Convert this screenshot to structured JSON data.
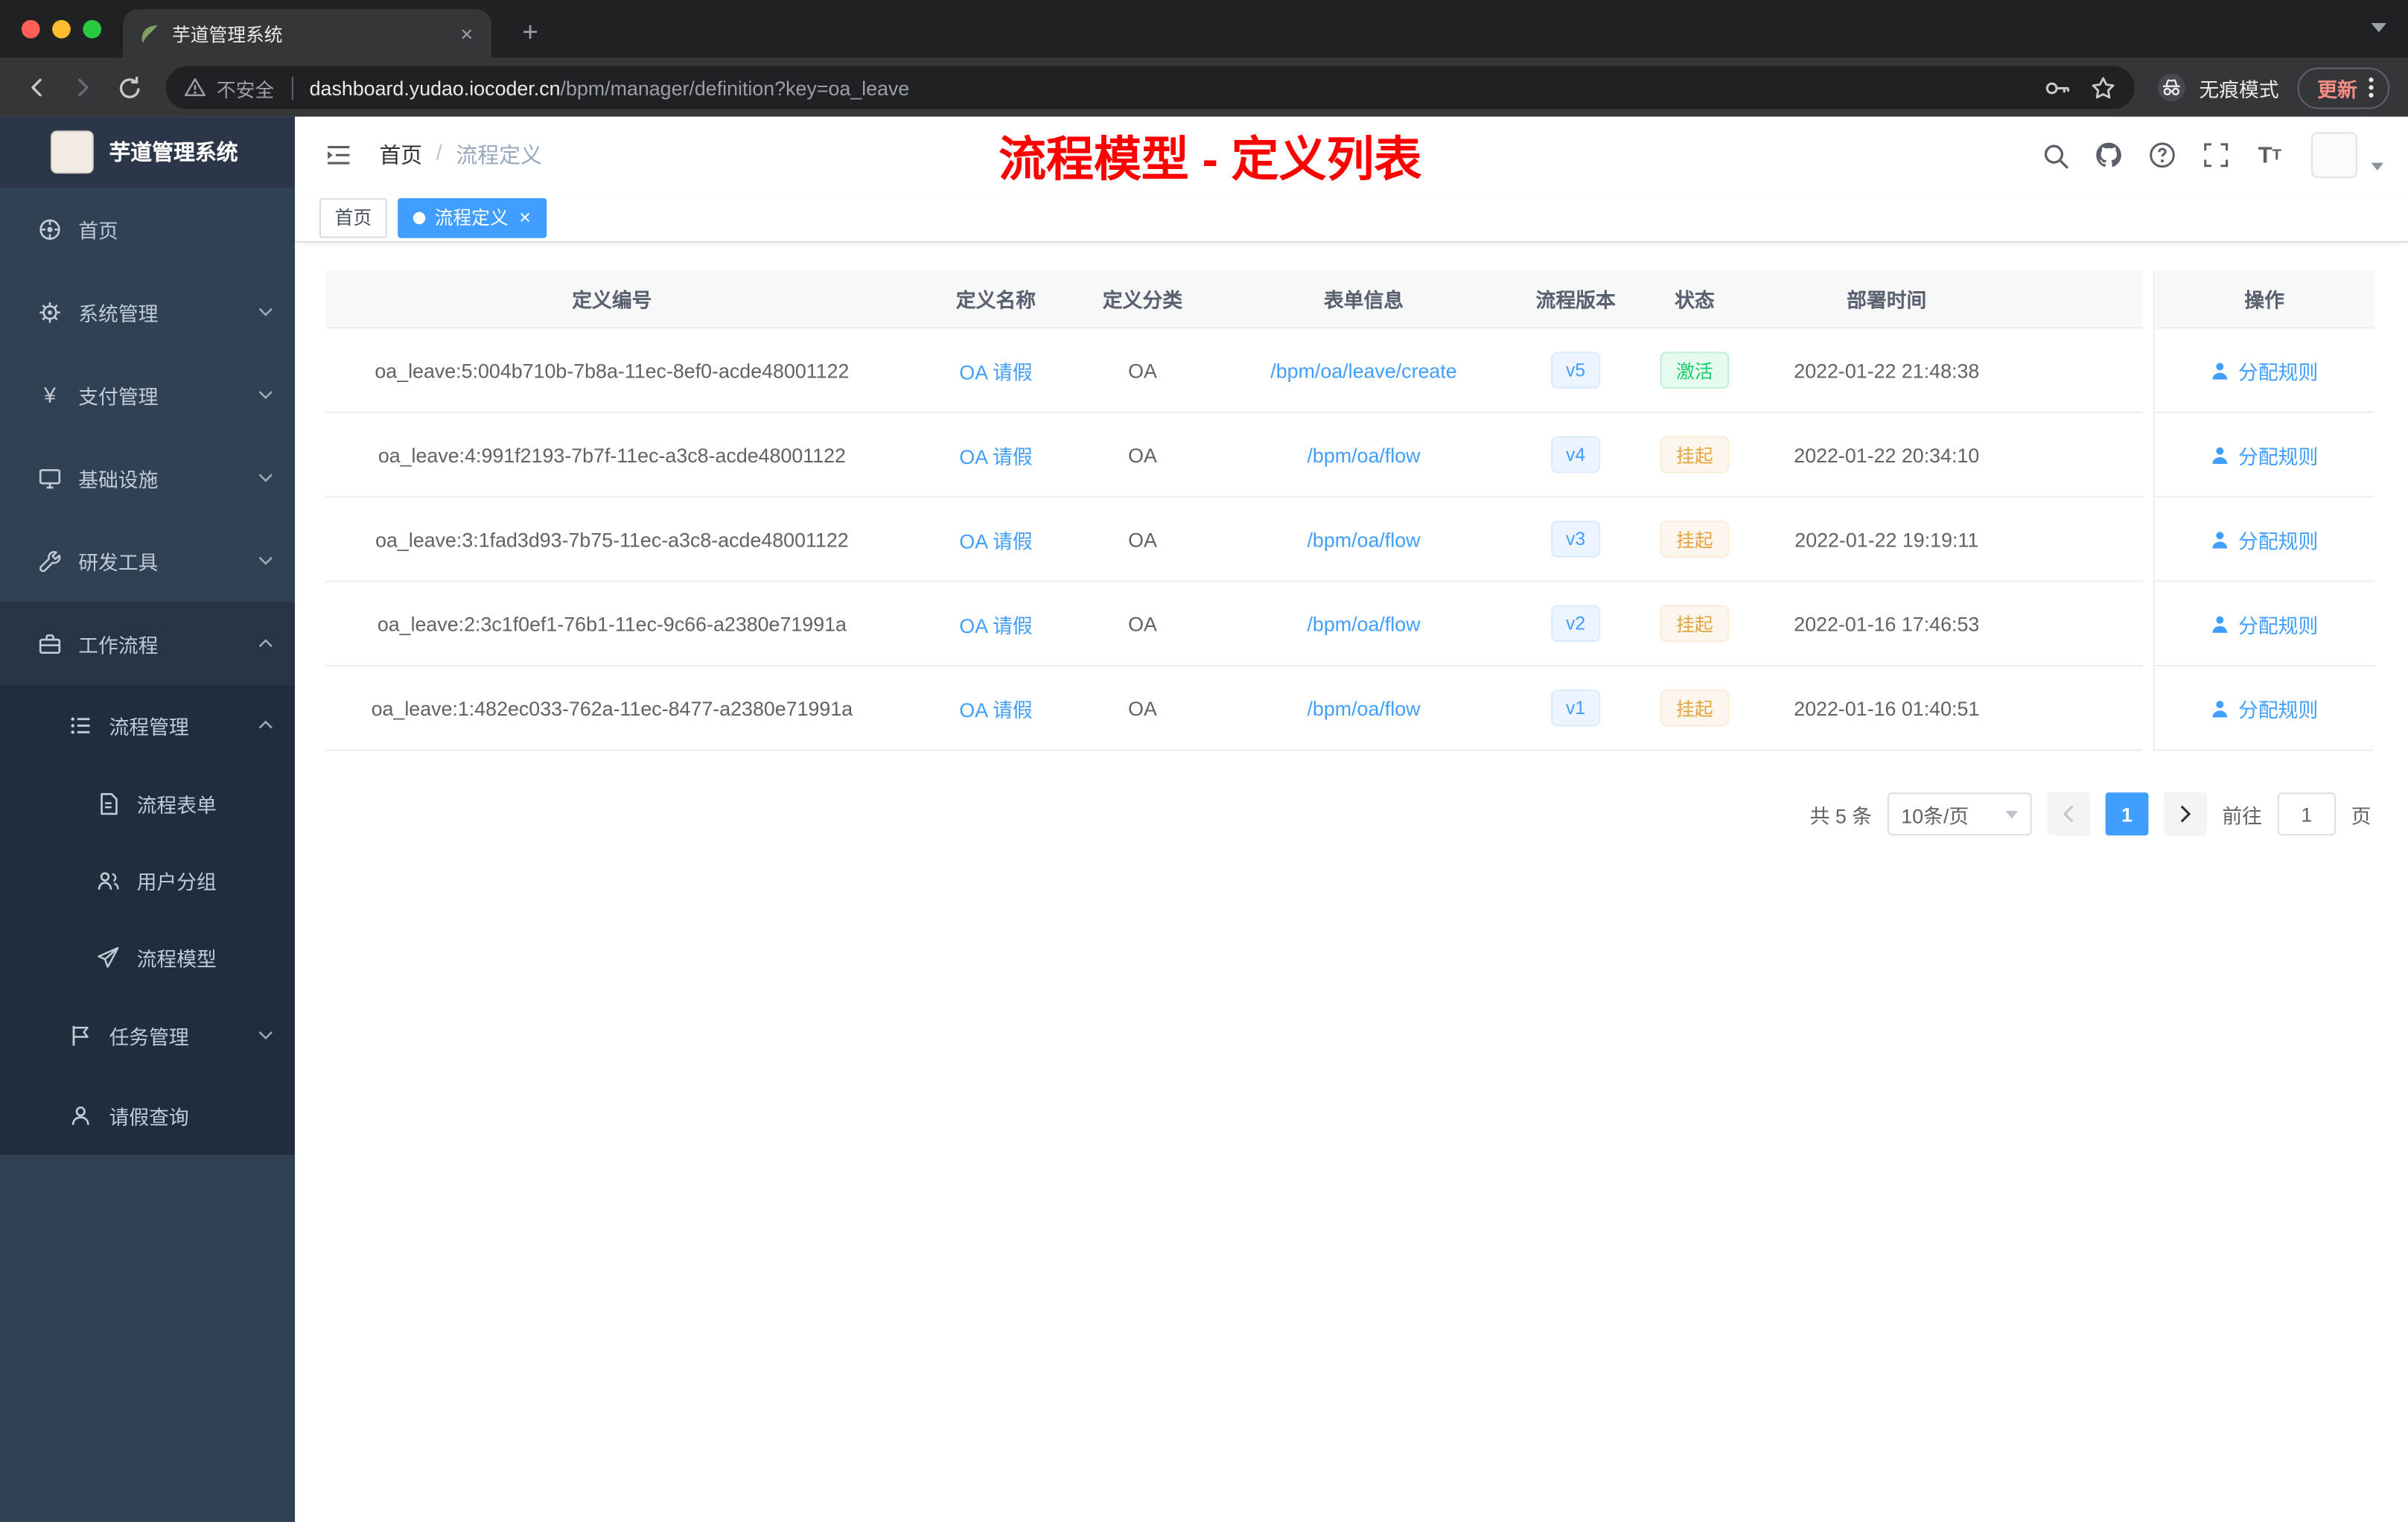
{
  "glyphs": {
    "plus": "+",
    "close": "×",
    "yen": "¥"
  },
  "colors": {
    "accent": "#409EFF",
    "sidebar_bg": "#304156",
    "success": "#13ce66",
    "warning": "#e6a23c",
    "annotation_red": "#fd0000"
  },
  "browser": {
    "tab_title": "芋道管理系统",
    "security_label": "不安全",
    "url_domain": "dashboard.yudao.iocoder.cn",
    "url_path": "/bpm/manager/definition?key=oa_leave",
    "incognito_label": "无痕模式",
    "update_label": "更新"
  },
  "sidebar": {
    "title": "芋道管理系统",
    "menu": [
      {
        "label": "首页",
        "icon": "dashboard-icon"
      },
      {
        "label": "系统管理",
        "icon": "gear-icon"
      },
      {
        "label": "支付管理",
        "icon": "yen-icon"
      },
      {
        "label": "基础设施",
        "icon": "monitor-icon"
      },
      {
        "label": "研发工具",
        "icon": "wrench-icon"
      },
      {
        "label": "工作流程",
        "icon": "briefcase-icon",
        "expanded": true
      },
      {
        "label": "流程管理",
        "icon": "list-icon",
        "expanded": true
      },
      {
        "label": "流程表单",
        "icon": "document-icon"
      },
      {
        "label": "用户分组",
        "icon": "user-group-icon"
      },
      {
        "label": "流程模型",
        "icon": "paper-plane-icon"
      },
      {
        "label": "任务管理",
        "icon": "flag-icon"
      },
      {
        "label": "请假查询",
        "icon": "person-icon"
      }
    ]
  },
  "navbar": {
    "breadcrumb": {
      "home": "首页",
      "separator": "/",
      "current": "流程定义"
    },
    "annotation": "流程模型 - 定义列表"
  },
  "tags": [
    {
      "label": "首页",
      "active": false
    },
    {
      "label": "流程定义",
      "active": true
    }
  ],
  "table": {
    "headers": [
      "定义编号",
      "定义名称",
      "定义分类",
      "表单信息",
      "流程版本",
      "状态",
      "部署时间",
      "操作"
    ],
    "rows": [
      {
        "id": "oa_leave:5:004b710b-7b8a-11ec-8ef0-acde48001122",
        "name": "OA 请假",
        "category": "OA",
        "form": "/bpm/oa/leave/create",
        "version": "v5",
        "status": "激活",
        "status_type": "success",
        "deploy_time": "2022-01-22 21:48:38",
        "action": "分配规则"
      },
      {
        "id": "oa_leave:4:991f2193-7b7f-11ec-a3c8-acde48001122",
        "name": "OA 请假",
        "category": "OA",
        "form": "/bpm/oa/flow",
        "version": "v4",
        "status": "挂起",
        "status_type": "warning",
        "deploy_time": "2022-01-22 20:34:10",
        "action": "分配规则"
      },
      {
        "id": "oa_leave:3:1fad3d93-7b75-11ec-a3c8-acde48001122",
        "name": "OA 请假",
        "category": "OA",
        "form": "/bpm/oa/flow",
        "version": "v3",
        "status": "挂起",
        "status_type": "warning",
        "deploy_time": "2022-01-22 19:19:11",
        "action": "分配规则"
      },
      {
        "id": "oa_leave:2:3c1f0ef1-76b1-11ec-9c66-a2380e71991a",
        "name": "OA 请假",
        "category": "OA",
        "form": "/bpm/oa/flow",
        "version": "v2",
        "status": "挂起",
        "status_type": "warning",
        "deploy_time": "2022-01-16 17:46:53",
        "action": "分配规则"
      },
      {
        "id": "oa_leave:1:482ec033-762a-11ec-8477-a2380e71991a",
        "name": "OA 请假",
        "category": "OA",
        "form": "/bpm/oa/flow",
        "version": "v1",
        "status": "挂起",
        "status_type": "warning",
        "deploy_time": "2022-01-16 01:40:51",
        "action": "分配规则"
      }
    ]
  },
  "pagination": {
    "total": "共 5 条",
    "page_size": "10条/页",
    "current_page": "1",
    "goto_label": "前往",
    "goto_value": "1",
    "page_unit": "页"
  }
}
